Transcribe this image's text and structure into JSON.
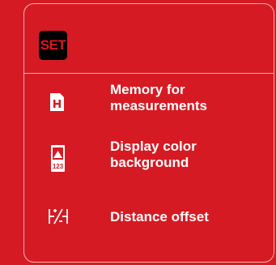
{
  "badge": {
    "label": "SET"
  },
  "menu": {
    "items": [
      {
        "icon": "memory-icon",
        "label": "Memory for\nmeasurements"
      },
      {
        "icon": "display-color-icon",
        "label": "Display color\nbackground",
        "icon_text": "123"
      },
      {
        "icon": "distance-offset-icon",
        "label": "Distance offset"
      }
    ]
  },
  "colors": {
    "background": "#d61a23",
    "border": "#f1b3b6",
    "badge_bg": "#000000",
    "badge_text": "#e0171f",
    "text": "#ffffff"
  }
}
